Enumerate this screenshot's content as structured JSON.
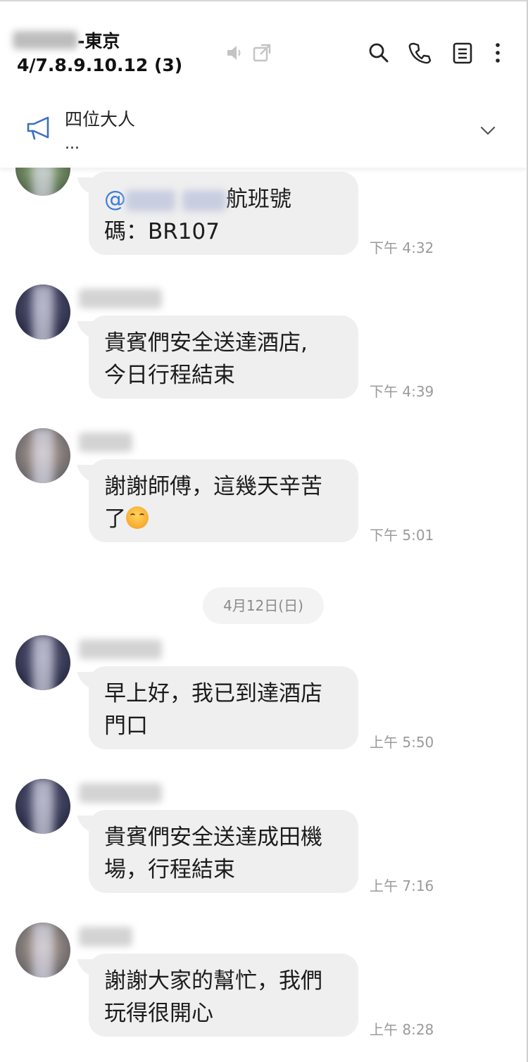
{
  "header": {
    "title_suffix": "-東京",
    "subtitle": "4/7.8.9.10.12 (3)",
    "icons": [
      "mute-icon",
      "popout-icon",
      "search-icon",
      "phone-icon",
      "notes-icon",
      "more-icon"
    ]
  },
  "announcement": {
    "title": "四位大人",
    "subtitle": "...",
    "icon": "megaphone-icon"
  },
  "date_separator": "4月12日(日)",
  "messages": [
    {
      "at": "@",
      "text": "航班號碼：BR107",
      "time": "下午 4:32"
    },
    {
      "text": "貴賓們安全送達酒店,今日行程結束",
      "line1": "貴賓們安全送達酒店,",
      "line2": "今日行程結束",
      "time": "下午 4:39"
    },
    {
      "line1": "謝謝師傅，這幾天辛苦",
      "line2": "了",
      "time": "下午 5:01"
    },
    {
      "line1": "早上好，我已到達酒店",
      "line2": "門口",
      "time": "上午 5:50"
    },
    {
      "line1": "貴賓們安全送達成田機",
      "line2": "場，行程結束",
      "time": "上午 7:16"
    },
    {
      "line1": "謝謝大家的幫忙，我們",
      "line2": "玩得很開心",
      "time": "上午 8:28"
    }
  ],
  "first_message": {
    "line1_suffix": "航班號",
    "line2": "碼：BR107"
  },
  "colors": {
    "mention": "#3b7dd8",
    "bubble": "#efefef",
    "time": "#9a9a9a",
    "announce_icon": "#3b6fc4"
  }
}
